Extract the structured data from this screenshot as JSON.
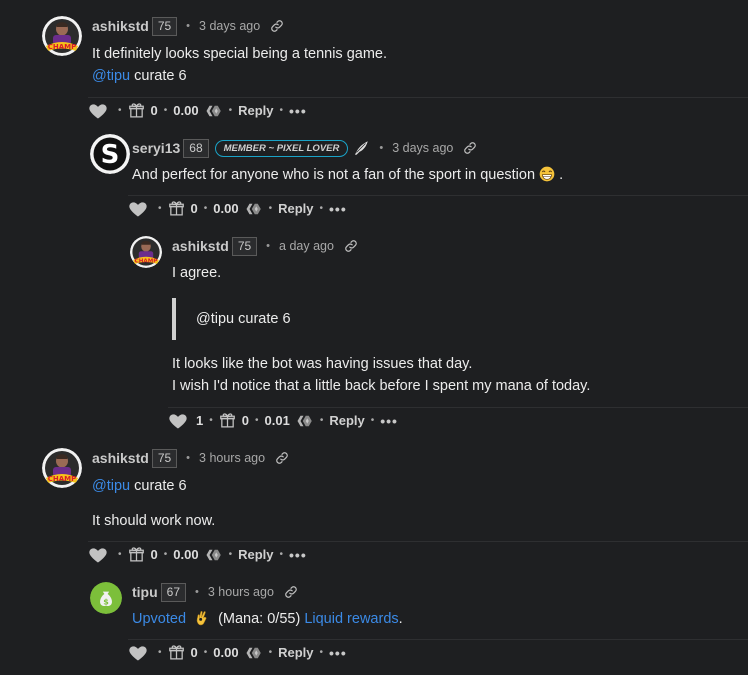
{
  "comments": [
    {
      "username": "ashikstd",
      "rep": "75",
      "time": "3 days ago",
      "mention": "@tipu",
      "lines": [
        "It definitely looks special being a tennis game.",
        "curate 6"
      ],
      "gifts": "0",
      "payout": "0.00",
      "reply": "Reply"
    },
    {
      "username": "seryi13",
      "rep": "68",
      "badge_prefix": "MEMBER ~ ",
      "badge_main": "PIXEL LOVER",
      "time": "3 days ago",
      "lines": [
        "And perfect for anyone who is not a fan of the sport in question",
        "."
      ],
      "gifts": "0",
      "payout": "0.00",
      "reply": "Reply"
    },
    {
      "username": "ashikstd",
      "rep": "75",
      "time": "a day ago",
      "lines": [
        "I agree.",
        "@tipu curate 6",
        "It looks like the bot was having issues that day.",
        "I wish I'd notice that a little back before I spent my mana of today."
      ],
      "votes": "1",
      "gifts": "0",
      "payout": "0.01",
      "reply": "Reply"
    },
    {
      "username": "ashikstd",
      "rep": "75",
      "time": "3 hours ago",
      "mention": "@tipu",
      "lines": [
        "curate 6",
        "It should work now."
      ],
      "gifts": "0",
      "payout": "0.00",
      "reply": "Reply"
    },
    {
      "username": "tipu",
      "rep": "67",
      "time": "3 hours ago",
      "upvoted": "Upvoted",
      "mana": "(Mana: 0/55)",
      "liquid": "Liquid rewards",
      "tail": ".",
      "gifts": "0",
      "payout": "0.00",
      "reply": "Reply"
    }
  ],
  "icons": {
    "like": "heart-icon",
    "gift": "gift-icon",
    "hive": "hive-icon",
    "more": "more-icon",
    "link": "link-icon",
    "ok": "ok-hand-emoji",
    "grin": "grin-emoji"
  },
  "colors": {
    "link": "#3b8ae6",
    "badge_border": "#1aa3c7",
    "background": "#1e1f21"
  }
}
